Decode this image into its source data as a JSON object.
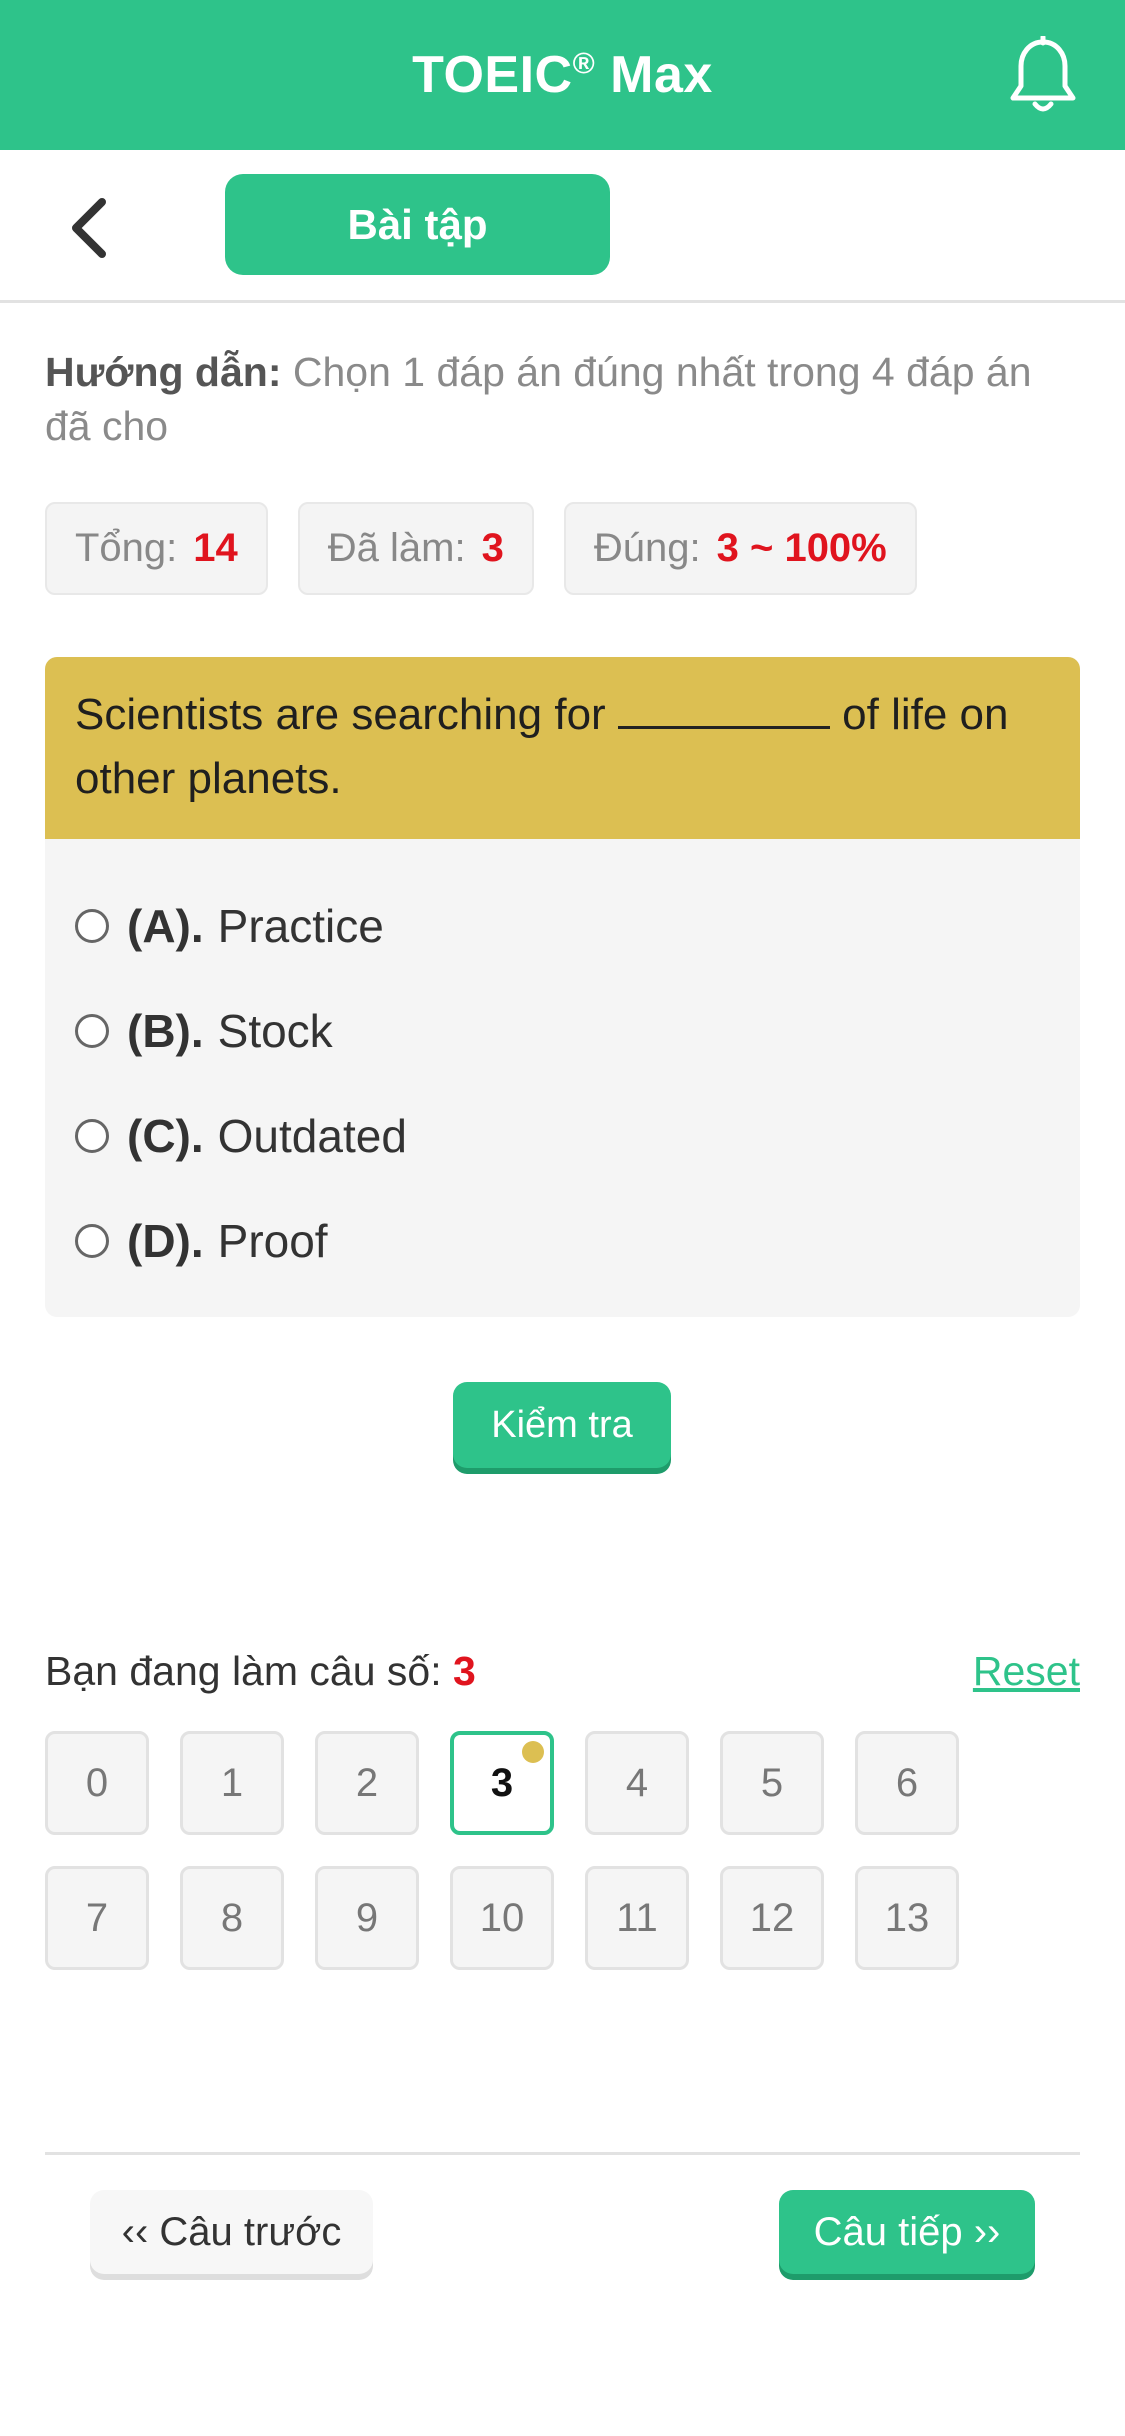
{
  "header": {
    "title": "TOEIC",
    "title_mark": "®",
    "title_suffix": " Max",
    "bell_icon": "bell-icon",
    "color": "#2ec38a"
  },
  "subbar": {
    "back_icon": "chevron-left-icon",
    "tab_label": "Bài tập"
  },
  "instructions": {
    "label": "Hướng dẫn:",
    "text": " Chọn 1 đáp án đúng nhất trong 4 đáp án đã cho"
  },
  "stats": {
    "total_label": "Tổng:",
    "total_value": "14",
    "done_label": "Đã làm:",
    "done_value": "3",
    "correct_label": "Đúng:",
    "correct_value": "3 ~ 100%"
  },
  "question": {
    "text_before": "Scientists are searching for ",
    "text_after": " of life on other planets.",
    "options": [
      {
        "key": "(A).",
        "text": "Practice"
      },
      {
        "key": "(B).",
        "text": "Stock"
      },
      {
        "key": "(C).",
        "text": "Outdated"
      },
      {
        "key": "(D).",
        "text": "Proof"
      }
    ]
  },
  "check_button": "Kiểm tra",
  "progress": {
    "label": "Bạn đang làm câu số: ",
    "current": "3",
    "reset": "Reset"
  },
  "question_numbers": [
    "0",
    "1",
    "2",
    "3",
    "4",
    "5",
    "6",
    "7",
    "8",
    "9",
    "10",
    "11",
    "12",
    "13"
  ],
  "nav": {
    "prev": "‹‹ Câu trước",
    "next": "Câu tiếp ››"
  }
}
